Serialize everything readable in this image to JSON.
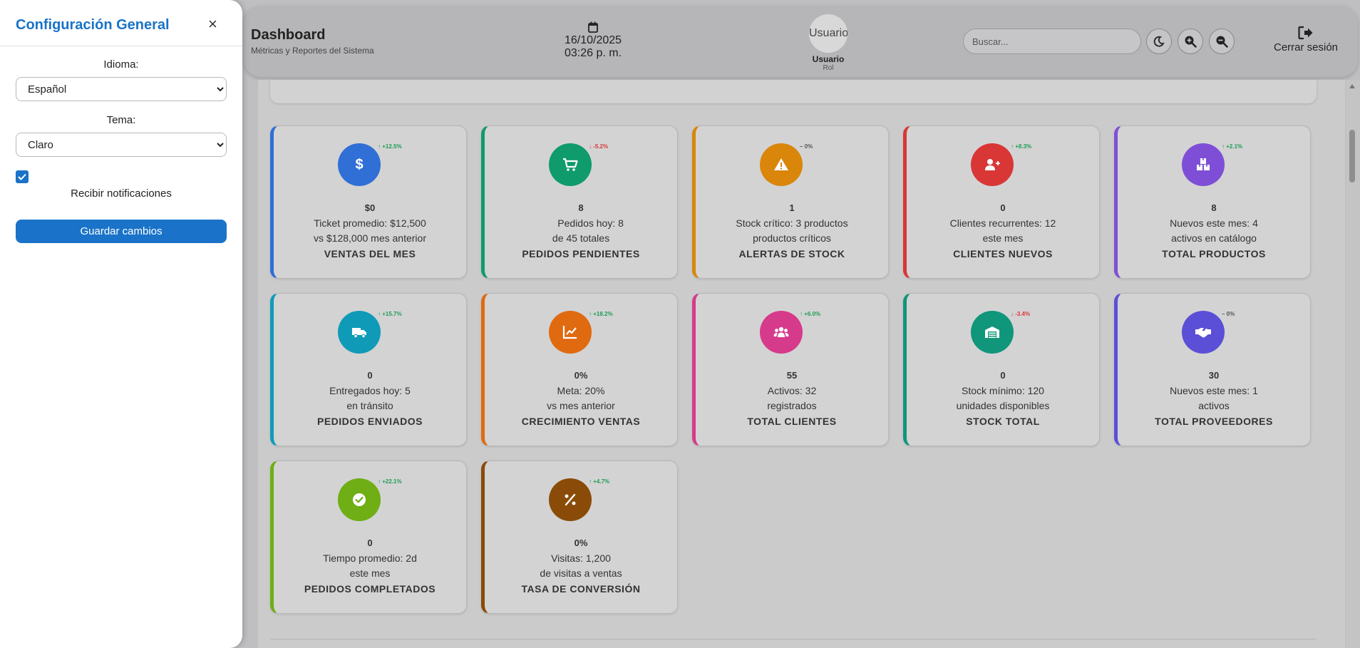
{
  "header": {
    "title": "Dashboard",
    "subtitle": "Métricas y Reportes del Sistema",
    "date": "16/10/2025",
    "time": "03:26 p. m.",
    "user_avatar_alt": "Usuario",
    "user_name": "Usuario",
    "user_role": "Rol",
    "search_placeholder": "Buscar...",
    "logout_label": "Cerrar sesión"
  },
  "config_panel": {
    "title": "Configuración General",
    "close_symbol": "×",
    "language_label": "Idioma:",
    "language_value": "Español",
    "theme_label": "Tema:",
    "theme_value": "Claro",
    "notifications_checked": true,
    "notifications_label": "Recibir notificaciones",
    "save_label": "Guardar cambios"
  },
  "cards": [
    {
      "icon": "dollar-icon",
      "color": "#2f6fd6",
      "trend": "↑ +12.5%",
      "trend_color": "#1f9d55",
      "value": "$0",
      "line1": "Ticket promedio: $12,500",
      "line2": "vs $128,000 mes anterior",
      "label": "VENTAS DEL MES"
    },
    {
      "icon": "cart-icon",
      "color": "#0f9b6c",
      "trend": "↓ -5.2%",
      "trend_color": "#d93636",
      "value": "8",
      "line1": "       Pedidos hoy: 8",
      "line2": "de 45 totales",
      "label": "PEDIDOS PENDIENTES"
    },
    {
      "icon": "warning-icon",
      "color": "#d9860b",
      "trend": "– 0%",
      "trend_color": "#555555",
      "value": "1",
      "line1": "Stock crítico: 3 productos",
      "line2": "productos críticos",
      "label": "ALERTAS DE STOCK"
    },
    {
      "icon": "user-plus-icon",
      "color": "#d93636",
      "trend": "↑ +8.3%",
      "trend_color": "#1f9d55",
      "value": "0",
      "line1": "Clientes recurrentes: 12",
      "line2": "este mes",
      "label": "CLIENTES NUEVOS"
    },
    {
      "icon": "boxes-icon",
      "color": "#7e4fd6",
      "trend": "↑ +2.1%",
      "trend_color": "#1f9d55",
      "value": "8",
      "line1": "Nuevos este mes: 4",
      "line2": "activos en catálogo",
      "label": "TOTAL PRODUCTOS"
    },
    {
      "icon": "truck-icon",
      "color": "#0f9bb8",
      "trend": "↑ +15.7%",
      "trend_color": "#1f9d55",
      "value": "0",
      "line1": "Entregados hoy: 5",
      "line2": "en tránsito",
      "label": "PEDIDOS ENVIADOS"
    },
    {
      "icon": "chart-line-icon",
      "color": "#e06a10",
      "trend": "↑ +18.2%",
      "trend_color": "#1f9d55",
      "value": "0%",
      "line1": "Meta: 20%",
      "line2": "vs mes anterior",
      "label": "CRECIMIENTO VENTAS"
    },
    {
      "icon": "users-icon",
      "color": "#d63a8a",
      "trend": "↑ +6.0%",
      "trend_color": "#1f9d55",
      "value": "55",
      "line1": "Activos: 32",
      "line2": "registrados",
      "label": "TOTAL CLIENTES"
    },
    {
      "icon": "warehouse-icon",
      "color": "#10967a",
      "trend": "↓ -3.4%",
      "trend_color": "#d93636",
      "value": "0",
      "line1": "Stock mínimo: 120",
      "line2": "unidades disponibles",
      "label": "STOCK TOTAL"
    },
    {
      "icon": "handshake-icon",
      "color": "#5a4fd6",
      "trend": "– 0%",
      "trend_color": "#555555",
      "value": "30",
      "line1": "Nuevos este mes: 1",
      "line2": "activos",
      "label": "TOTAL PROVEEDORES"
    },
    {
      "icon": "check-circle-icon",
      "color": "#6fae14",
      "trend": "↑ +22.1%",
      "trend_color": "#1f9d55",
      "value": "0",
      "line1": "Tiempo promedio: 2d",
      "line2": "este mes",
      "label": "PEDIDOS COMPLETADOS"
    },
    {
      "icon": "percent-icon",
      "color": "#8a4b08",
      "trend": "↑ +4.7%",
      "trend_color": "#1f9d55",
      "value": "0%",
      "line1": "Visitas: 1,200",
      "line2": "de visitas a ventas",
      "label": "TASA DE CONVERSIÓN"
    }
  ]
}
